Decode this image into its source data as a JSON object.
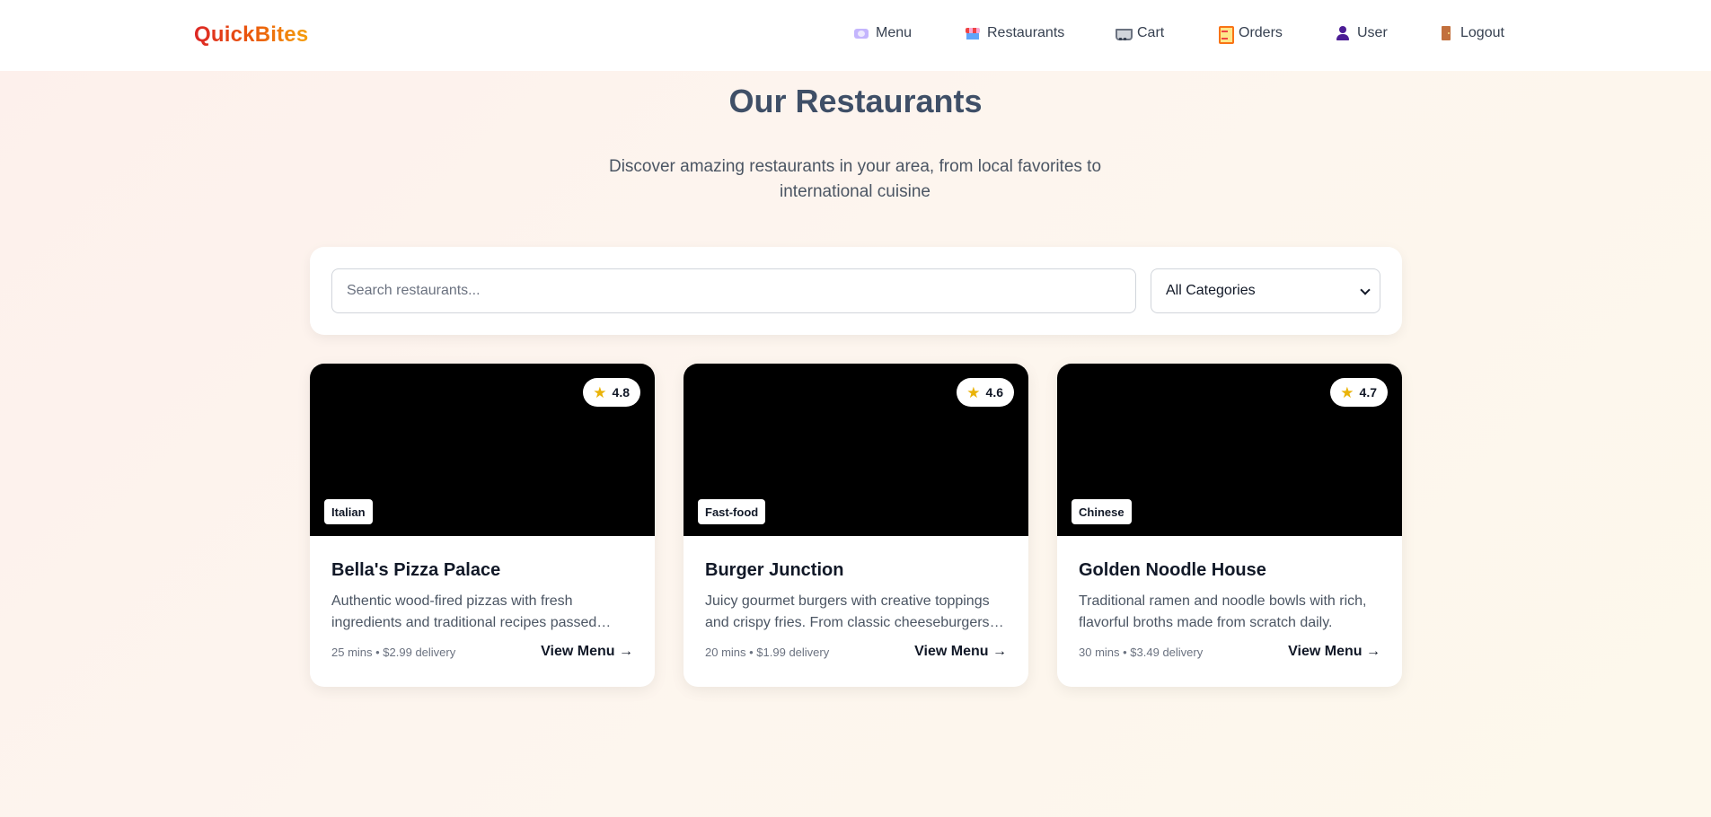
{
  "header": {
    "logo": "QuickBites",
    "nav": [
      {
        "label": "Menu",
        "icon": "menu-plate-icon"
      },
      {
        "label": "Restaurants",
        "icon": "restaurant-icon"
      },
      {
        "label": "Cart",
        "icon": "cart-icon"
      },
      {
        "label": "Orders",
        "icon": "clipboard-icon"
      },
      {
        "label": "User",
        "icon": "user-icon"
      },
      {
        "label": "Logout",
        "icon": "door-icon"
      }
    ]
  },
  "hero": {
    "title": "Our Restaurants",
    "subtitle": "Discover amazing restaurants in your area, from local favorites to international cuisine"
  },
  "filters": {
    "search_placeholder": "Search restaurants...",
    "search_value": "",
    "category_selected": "All Categories"
  },
  "restaurants": [
    {
      "name": "Bella's Pizza Palace",
      "category": "Italian",
      "rating": "4.8",
      "description": "Authentic wood-fired pizzas with fresh ingredients and traditional recipes passed…",
      "meta": "25 mins • $2.99 delivery",
      "cta": "View Menu →"
    },
    {
      "name": "Burger Junction",
      "category": "Fast-food",
      "rating": "4.6",
      "description": "Juicy gourmet burgers with creative toppings and crispy fries. From classic cheeseburgers t…",
      "meta": "20 mins • $1.99 delivery",
      "cta": "View Menu →"
    },
    {
      "name": "Golden Noodle House",
      "category": "Chinese",
      "rating": "4.7",
      "description": "Traditional ramen and noodle bowls with rich, flavorful broths made from scratch daily.",
      "meta": "30 mins • $3.49 delivery",
      "cta": "View Menu →"
    }
  ],
  "colors": {
    "logo_gradient": [
      "#dc2626",
      "#f59e0b"
    ],
    "title": "#3f4f67",
    "star": "#eab308"
  }
}
